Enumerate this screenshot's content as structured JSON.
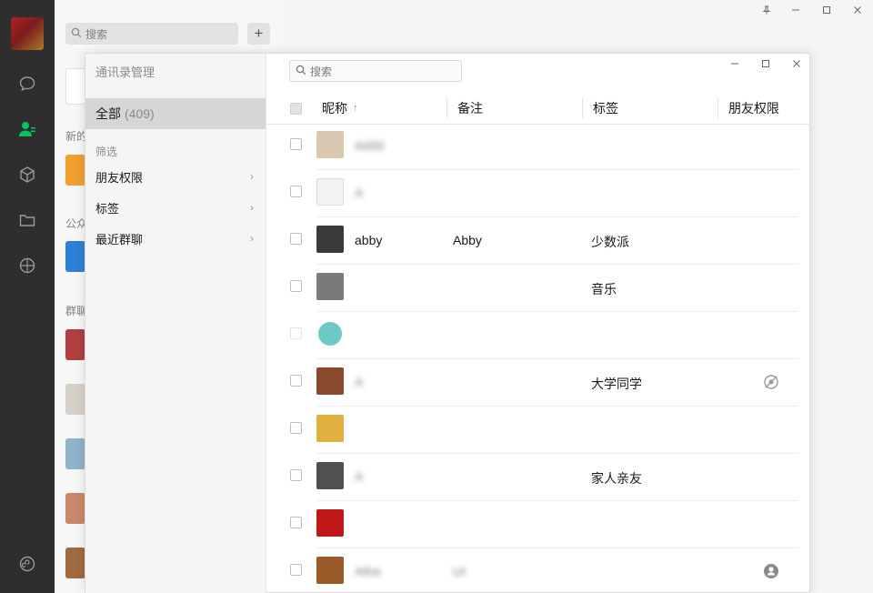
{
  "sidebar_search": {
    "placeholder": "搜索",
    "add": "+"
  },
  "background_labels": {
    "new_friends": "新的",
    "official": "公众",
    "groups": "群聊"
  },
  "dialog": {
    "title": "通讯录管理",
    "all_label": "全部",
    "all_count": "(409)",
    "filter_heading": "筛选",
    "filters": [
      {
        "label": "朋友权限"
      },
      {
        "label": "标签"
      },
      {
        "label": "最近群聊"
      }
    ],
    "search_placeholder": "搜索",
    "columns": {
      "nickname": "昵称",
      "sort_arrow": "↑",
      "remark": "备注",
      "tag": "标签",
      "permission": "朋友权限"
    },
    "rows": [
      {
        "name": "A000",
        "note": "",
        "tag": "",
        "perm_icon": "",
        "avatar": "#c8b9a0"
      },
      {
        "name": "A",
        "note": "",
        "tag": "",
        "perm_icon": "",
        "avatar": "#e0e0e0"
      },
      {
        "name": "abby",
        "note": "Abby",
        "tag": "少数派",
        "perm_icon": "",
        "avatar": "#3a3a3a"
      },
      {
        "name": "",
        "note": "",
        "tag": "音乐",
        "perm_icon": "",
        "avatar": "#7a7a7a"
      },
      {
        "name": "",
        "note": "",
        "tag": "",
        "perm_icon": "",
        "avatar": "#6cc9c6"
      },
      {
        "name": "A",
        "note": "",
        "tag": "大学同学",
        "perm_icon": "eye-off-icon",
        "avatar": "#8a4a30"
      },
      {
        "name": "",
        "note": "",
        "tag": "",
        "perm_icon": "",
        "avatar": "#e0b040"
      },
      {
        "name": "A",
        "note": "",
        "tag": "家人亲友",
        "perm_icon": "",
        "avatar": "#505050"
      },
      {
        "name": "",
        "note": "",
        "tag": "",
        "perm_icon": "",
        "avatar": "#c01818"
      },
      {
        "name": "Aiha",
        "note": "UI",
        "tag": "",
        "perm_icon": "person-circle-icon",
        "avatar": "#9a5a2a"
      }
    ]
  }
}
